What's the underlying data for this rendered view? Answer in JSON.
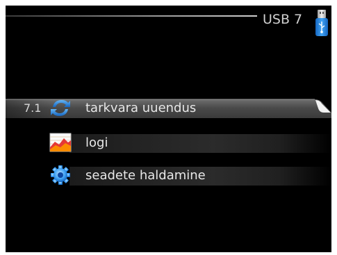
{
  "header": {
    "title": "USB 7",
    "icon": "usb-drive-icon"
  },
  "menu": {
    "items": [
      {
        "number": "7.1",
        "label": "tarkvara uuendus",
        "icon": "refresh-icon",
        "selected": true
      },
      {
        "number": "",
        "label": "logi",
        "icon": "log-chart-icon",
        "selected": false
      },
      {
        "number": "",
        "label": "seadete haldamine",
        "icon": "gear-icon",
        "selected": false
      }
    ]
  },
  "colors": {
    "background": "#000000",
    "selection_bar": "#5a5a5a",
    "accent_blue": "#1e88e5",
    "text": "#e8e8e8"
  }
}
